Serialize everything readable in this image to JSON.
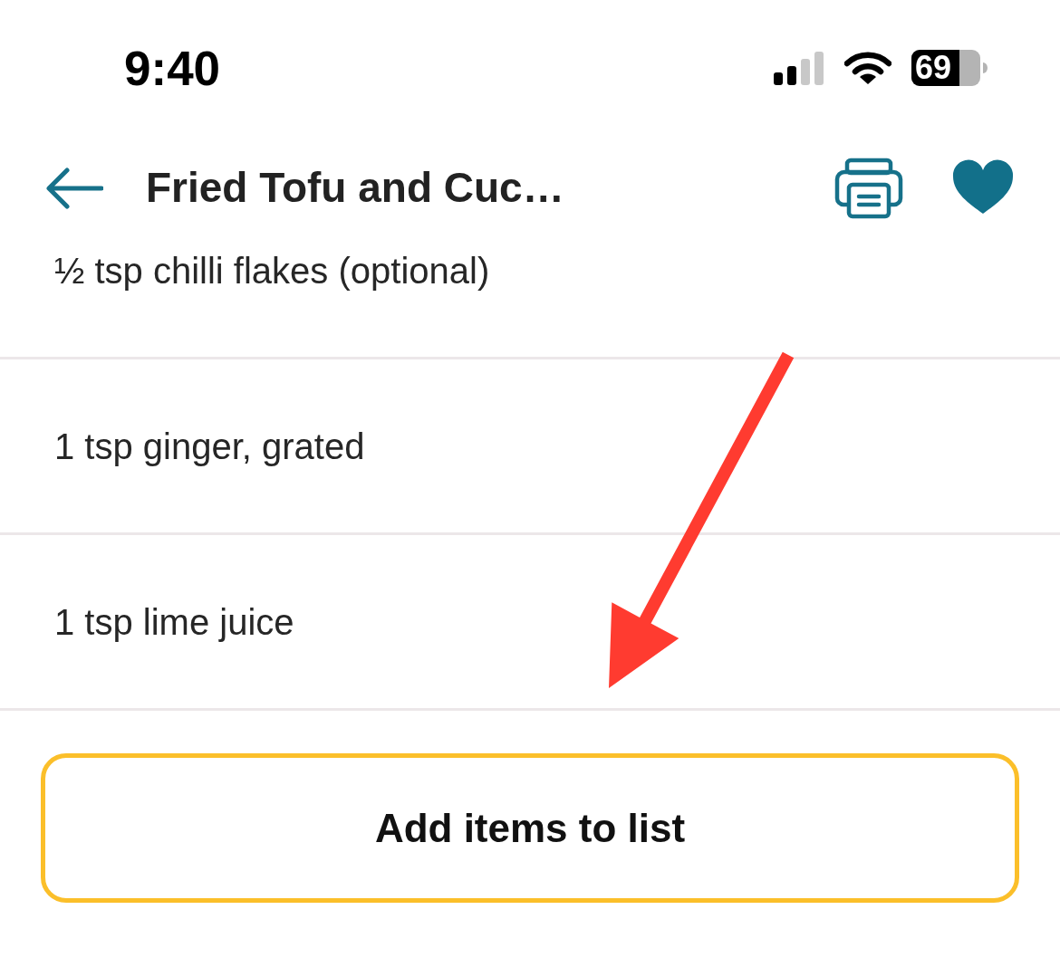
{
  "status_bar": {
    "time": "9:40",
    "battery": "69"
  },
  "header": {
    "title": "Fried Tofu and Cuc…",
    "favorite": true
  },
  "ingredients": [
    {
      "text": "½ tsp chilli flakes (optional)"
    },
    {
      "text": "1 tsp ginger, grated"
    },
    {
      "text": "1 tsp lime juice"
    }
  ],
  "add_button": {
    "label": "Add items to list"
  },
  "annotations": [
    {
      "kind": "arrow"
    }
  ]
}
